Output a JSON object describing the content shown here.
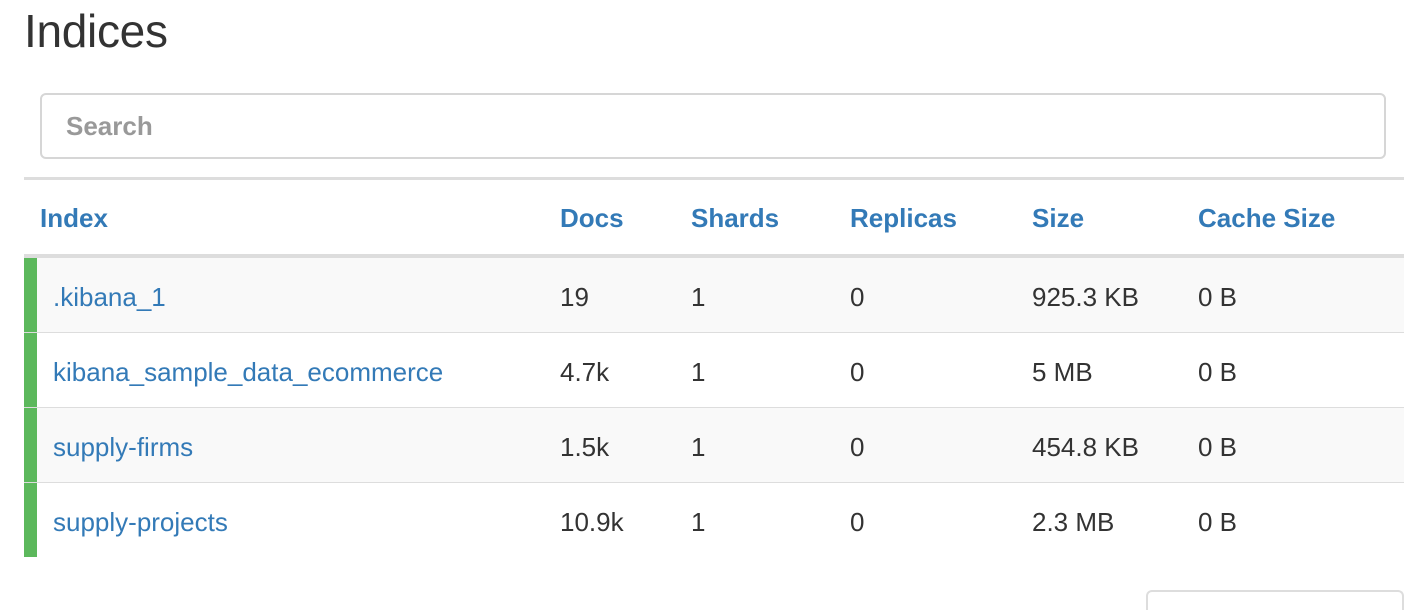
{
  "page": {
    "title": "Indices"
  },
  "search": {
    "placeholder": "Search",
    "value": ""
  },
  "table": {
    "columns": {
      "index": "Index",
      "docs": "Docs",
      "shards": "Shards",
      "replicas": "Replicas",
      "size": "Size",
      "cache_size": "Cache Size"
    },
    "rows": [
      {
        "index": ".kibana_1",
        "docs": "19",
        "shards": "1",
        "replicas": "0",
        "size": "925.3 KB",
        "cache_size": "0 B"
      },
      {
        "index": "kibana_sample_data_ecommerce",
        "docs": "4.7k",
        "shards": "1",
        "replicas": "0",
        "size": "5 MB",
        "cache_size": "0 B"
      },
      {
        "index": "supply-firms",
        "docs": "1.5k",
        "shards": "1",
        "replicas": "0",
        "size": "454.8 KB",
        "cache_size": "0 B"
      },
      {
        "index": "supply-projects",
        "docs": "10.9k",
        "shards": "1",
        "replicas": "0",
        "size": "2.3 MB",
        "cache_size": "0 B"
      }
    ]
  },
  "colors": {
    "link": "#337ab7",
    "status_green": "#5cb85c",
    "row_stripe": "#f9f9f9",
    "border": "#dddddd"
  }
}
